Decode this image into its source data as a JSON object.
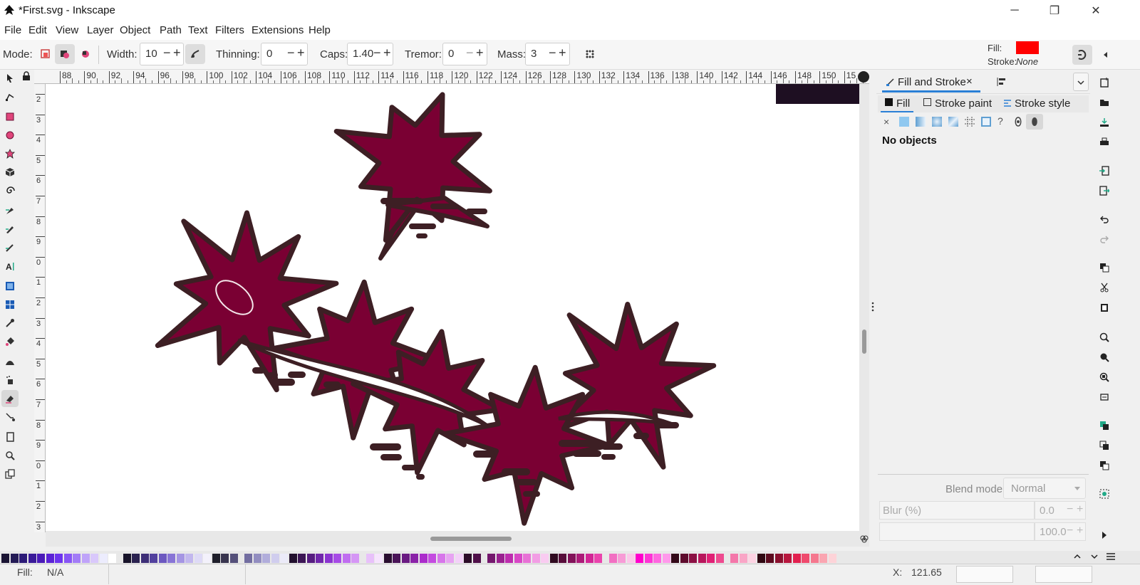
{
  "window": {
    "title": "*First.svg - Inkscape",
    "buttons": {
      "minimize": "─",
      "maximize": "❐",
      "close": "✕"
    }
  },
  "menu": [
    "File",
    "Edit",
    "View",
    "Layer",
    "Object",
    "Path",
    "Text",
    "Filters",
    "Extensions",
    "Help"
  ],
  "tool_controls": {
    "mode_label": "Mode:",
    "width_label": "Width:",
    "width_value": "10",
    "thinning_label": "Thinning:",
    "thinning_value": "0",
    "caps_label": "Caps:",
    "caps_value": "1.40",
    "tremor_label": "Tremor:",
    "tremor_value": "0",
    "mass_label": "Mass:",
    "mass_value": "3",
    "fill_label": "Fill:",
    "fill_color": "#ff0000",
    "stroke_label": "Stroke:",
    "stroke_value": "None"
  },
  "ruler_top_labels": [
    "88",
    "90",
    "92",
    "94",
    "96",
    "98",
    "100",
    "102",
    "104",
    "106",
    "108",
    "110",
    "112",
    "114",
    "116",
    "118",
    "120",
    "122",
    "124",
    "126",
    "128",
    "130",
    "132",
    "134",
    "136",
    "138",
    "140",
    "142",
    "144",
    "146",
    "148",
    "150",
    "15"
  ],
  "ruler_left_labels": [
    "2",
    "3",
    "4",
    "5",
    "6",
    "7",
    "8",
    "9",
    "0",
    "1",
    "2",
    "3",
    "4",
    "5",
    "6",
    "7",
    "8",
    "9",
    "0",
    "1",
    "2",
    "3"
  ],
  "canvas": {
    "shape_fill": "#7a0033",
    "shape_stroke": "#3d1f24",
    "dark_rect_color": "#1e0f22"
  },
  "panel": {
    "tab_label": "Fill and Stroke",
    "tab_close": "×",
    "subtabs": [
      "Fill",
      "Stroke paint",
      "Stroke style"
    ],
    "paint_buttons": [
      "×",
      "?"
    ],
    "message": "No objects",
    "blend_label": "Blend mode:",
    "blend_value": "Normal",
    "blur_label": "Blur (%)",
    "blur_value": "0.0",
    "opacity_value": "100.0"
  },
  "status": {
    "fill_label": "Fill:",
    "fill_value": "N/A",
    "x_label": "X:",
    "x_value": "121.65"
  },
  "palette_colors": [
    "#1a1433",
    "#231a55",
    "#2c1a77",
    "#3a1a99",
    "#4a1ab8",
    "#5b22d6",
    "#6d33ee",
    "#8855f5",
    "#a37cf7",
    "#bfa3f9",
    "#d9c8fb",
    "#ececfd",
    "#ffffff",
    "#18142a",
    "#2a2250",
    "#3d2e77",
    "#52409e",
    "#6c58c0",
    "#8874d6",
    "#a595e3",
    "#c2b7ee",
    "#dedaf6",
    "#f3f1fb",
    "#1e1e2a",
    "#38344e",
    "#55507a",
    "#726da0",
    "#928dc0",
    "#b1addb",
    "#d0cdee",
    "#ebeaf8",
    "#22102e",
    "#3c1655",
    "#561c80",
    "#7026ab",
    "#8b33d0",
    "#a74be6",
    "#c06df0",
    "#d596f5",
    "#e8c0fa",
    "#f6e4fd",
    "#2a0e30",
    "#4a1458",
    "#6a1a82",
    "#8a22a8",
    "#ab2ccb",
    "#c44be0",
    "#d775ea",
    "#e7a3f2",
    "#f3d1f8",
    "#2c0c28",
    "#50104a",
    "#74176d",
    "#99208f",
    "#bd2cae",
    "#d847c6",
    "#e871d6",
    "#f29de4",
    "#f9cbf1",
    "#300a20",
    "#580d3b",
    "#821259",
    "#ac1a78",
    "#d22595",
    "#ea43ad",
    "#f26fc2",
    "#f79bd6",
    "#fbc8e9",
    "#ff00cc",
    "#ff33d6",
    "#ff66e0",
    "#ff99eb",
    "#330818",
    "#5e0b2d",
    "#8b1044",
    "#b8165c",
    "#e02075",
    "#ee4a8f",
    "#f477aa",
    "#f9a5c6",
    "#fdd3e3",
    "#300812",
    "#5c0b1f",
    "#8a102e",
    "#b8173e",
    "#e2204f",
    "#ef4a6d",
    "#f5778e",
    "#faa5b1",
    "#fdd3d8"
  ]
}
